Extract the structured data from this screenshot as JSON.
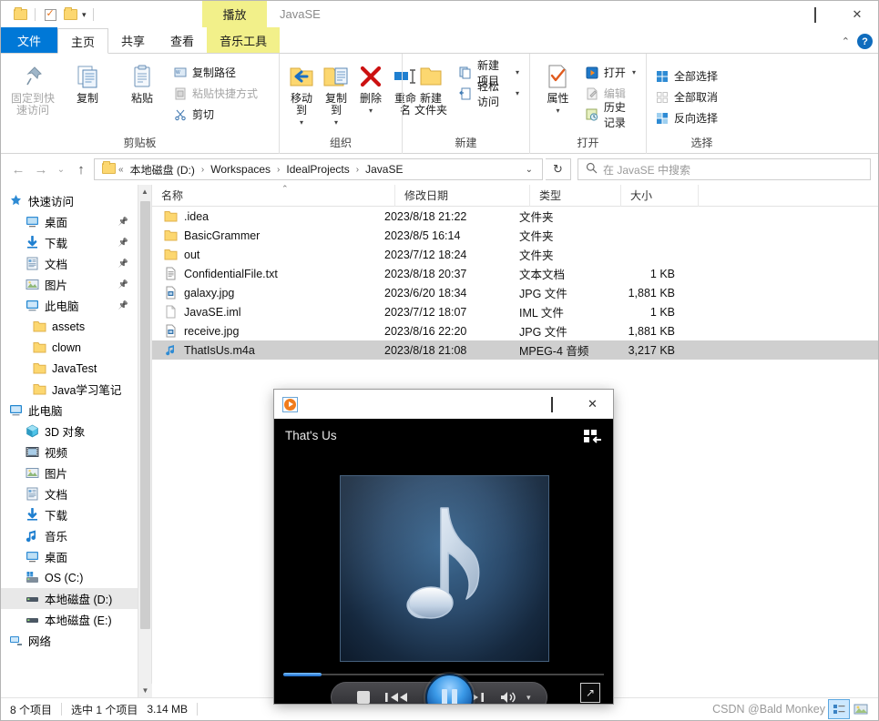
{
  "window": {
    "title": "JavaSE",
    "context_tab_top": "播放",
    "context_group_label": "音乐工具",
    "minimize": "—",
    "maximize": "□",
    "close": "✕",
    "collapse_ribbon": "⌃",
    "help": "?"
  },
  "ribbon": {
    "tabs": [
      {
        "label": "文件",
        "type": "file"
      },
      {
        "label": "主页",
        "type": "active"
      },
      {
        "label": "共享",
        "type": "normal"
      },
      {
        "label": "查看",
        "type": "normal"
      },
      {
        "label": "音乐工具",
        "type": "contextual"
      }
    ],
    "groups": [
      {
        "title": "剪贴板",
        "big": [
          {
            "label1": "固定到快",
            "label2": "速访问",
            "icon": "pin-icon",
            "disabled": true
          },
          {
            "label1": "复制",
            "label2": "",
            "icon": "copy-icon",
            "disabled": false
          },
          {
            "label1": "粘贴",
            "label2": "",
            "icon": "paste-icon",
            "disabled": false
          }
        ],
        "small": [
          {
            "label": "复制路径",
            "icon": "copy-path-icon"
          },
          {
            "label": "粘贴快捷方式",
            "icon": "paste-shortcut-icon",
            "disabled": true
          },
          {
            "label": "剪切",
            "icon": "scissors-icon"
          }
        ]
      },
      {
        "title": "组织",
        "big": [
          {
            "label1": "移动到",
            "label2": "",
            "icon": "move-to-icon",
            "caret": "▾"
          },
          {
            "label1": "复制到",
            "label2": "",
            "icon": "copy-to-icon",
            "caret": "▾"
          },
          {
            "label1": "删除",
            "label2": "",
            "icon": "delete-icon",
            "caret": "▾"
          },
          {
            "label1": "重命名",
            "label2": "",
            "icon": "rename-icon"
          }
        ]
      },
      {
        "title": "新建",
        "big": [
          {
            "label1": "新建",
            "label2": "文件夹",
            "icon": "new-folder-icon"
          }
        ],
        "small": [
          {
            "label": "新建项目",
            "icon": "new-item-icon",
            "caret": "▾"
          },
          {
            "label": "轻松访问",
            "icon": "easy-access-icon",
            "caret": "▾"
          }
        ]
      },
      {
        "title": "打开",
        "big": [
          {
            "label1": "属性",
            "label2": "",
            "icon": "properties-icon",
            "caret": "▾"
          }
        ],
        "small": [
          {
            "label": "打开",
            "icon": "open-icon",
            "caret": "▾"
          },
          {
            "label": "编辑",
            "icon": "edit-icon",
            "disabled": true
          },
          {
            "label": "历史记录",
            "icon": "history-icon"
          }
        ]
      },
      {
        "title": "选择",
        "small": [
          {
            "label": "全部选择",
            "icon": "select-all-icon"
          },
          {
            "label": "全部取消",
            "icon": "select-none-icon"
          },
          {
            "label": "反向选择",
            "icon": "invert-selection-icon"
          }
        ]
      }
    ]
  },
  "address": {
    "back": "←",
    "forward": "→",
    "recent": "⌄",
    "up": "↑",
    "prefix": "«",
    "crumbs": [
      "本地磁盘 (D:)",
      "Workspaces",
      "IdealProjects",
      "JavaSE"
    ],
    "separator": "›",
    "dropdown": "⌄",
    "refresh": "↻",
    "search_placeholder": "在 JavaSE 中搜索"
  },
  "nav": {
    "items": [
      {
        "label": "快速访问",
        "icon": "quick-access-star-icon",
        "indent": 0,
        "pinned": false,
        "selected": false
      },
      {
        "label": "桌面",
        "icon": "desktop-icon",
        "indent": 1,
        "pinned": true,
        "selected": false
      },
      {
        "label": "下载",
        "icon": "downloads-icon",
        "indent": 1,
        "pinned": true,
        "selected": false
      },
      {
        "label": "文档",
        "icon": "documents-icon",
        "indent": 1,
        "pinned": true,
        "selected": false
      },
      {
        "label": "图片",
        "icon": "pictures-icon",
        "indent": 1,
        "pinned": true,
        "selected": false
      },
      {
        "label": "此电脑",
        "icon": "this-pc-icon",
        "indent": 1,
        "pinned": true,
        "selected": false
      },
      {
        "label": "assets",
        "icon": "folder-icon",
        "indent": 2,
        "pinned": false,
        "selected": false
      },
      {
        "label": "clown",
        "icon": "folder-icon",
        "indent": 2,
        "pinned": false,
        "selected": false
      },
      {
        "label": "JavaTest",
        "icon": "folder-icon",
        "indent": 2,
        "pinned": false,
        "selected": false
      },
      {
        "label": "Java学习笔记",
        "icon": "folder-icon",
        "indent": 2,
        "pinned": false,
        "selected": false
      },
      {
        "label": "此电脑",
        "icon": "this-pc-icon",
        "indent": 0,
        "pinned": false,
        "selected": false
      },
      {
        "label": "3D 对象",
        "icon": "3d-objects-icon",
        "indent": 1,
        "pinned": false,
        "selected": false
      },
      {
        "label": "视频",
        "icon": "videos-icon",
        "indent": 1,
        "pinned": false,
        "selected": false
      },
      {
        "label": "图片",
        "icon": "pictures-icon",
        "indent": 1,
        "pinned": false,
        "selected": false
      },
      {
        "label": "文档",
        "icon": "documents-icon",
        "indent": 1,
        "pinned": false,
        "selected": false
      },
      {
        "label": "下载",
        "icon": "downloads-icon",
        "indent": 1,
        "pinned": false,
        "selected": false
      },
      {
        "label": "音乐",
        "icon": "music-icon",
        "indent": 1,
        "pinned": false,
        "selected": false
      },
      {
        "label": "桌面",
        "icon": "desktop-icon",
        "indent": 1,
        "pinned": false,
        "selected": false
      },
      {
        "label": "OS (C:)",
        "icon": "os-drive-icon",
        "indent": 1,
        "pinned": false,
        "selected": false
      },
      {
        "label": "本地磁盘 (D:)",
        "icon": "drive-icon",
        "indent": 1,
        "pinned": false,
        "selected": true
      },
      {
        "label": "本地磁盘 (E:)",
        "icon": "drive-icon",
        "indent": 1,
        "pinned": false,
        "selected": false
      },
      {
        "label": "网络",
        "icon": "network-icon",
        "indent": 0,
        "pinned": false,
        "selected": false
      }
    ]
  },
  "filelist": {
    "columns": [
      "名称",
      "修改日期",
      "类型",
      "大小"
    ],
    "sort_indicator": "⌃",
    "rows": [
      {
        "name": ".idea",
        "date": "2023/8/18 21:22",
        "type": "文件夹",
        "size": "",
        "icon": "folder-icon",
        "selected": false
      },
      {
        "name": "BasicGrammer",
        "date": "2023/8/5 16:14",
        "type": "文件夹",
        "size": "",
        "icon": "folder-icon",
        "selected": false
      },
      {
        "name": "out",
        "date": "2023/7/12 18:24",
        "type": "文件夹",
        "size": "",
        "icon": "folder-icon",
        "selected": false
      },
      {
        "name": "ConfidentialFile.txt",
        "date": "2023/8/18 20:37",
        "type": "文本文档",
        "size": "1 KB",
        "icon": "text-file-icon",
        "selected": false
      },
      {
        "name": "galaxy.jpg",
        "date": "2023/6/20 18:34",
        "type": "JPG 文件",
        "size": "1,881 KB",
        "icon": "image-file-icon",
        "selected": false
      },
      {
        "name": "JavaSE.iml",
        "date": "2023/7/12 18:07",
        "type": "IML 文件",
        "size": "1 KB",
        "icon": "blank-file-icon",
        "selected": false
      },
      {
        "name": "receive.jpg",
        "date": "2023/8/16 22:20",
        "type": "JPG 文件",
        "size": "1,881 KB",
        "icon": "image-file-icon",
        "selected": false
      },
      {
        "name": "ThatIsUs.m4a",
        "date": "2023/8/18 21:08",
        "type": "MPEG-4 音频",
        "size": "3,217 KB",
        "icon": "audio-file-icon",
        "selected": true
      }
    ]
  },
  "status": {
    "item_count": "8 个项目",
    "selection": "选中 1 个项目",
    "selection_size": "3.14 MB",
    "watermark": "CSDN @Bald Monkey",
    "view_details_icon": "details-view-icon",
    "view_large_icon": "large-icons-view-icon"
  },
  "player": {
    "logo": "wmp-logo-icon",
    "minimize": "—",
    "maximize": "□",
    "close": "✕",
    "song_title": "That's Us",
    "switch_to_library": "switch-to-library-icon",
    "album_art": "music-note-art",
    "seek_percent": "12",
    "controls": {
      "stop": "stop-icon",
      "previous": "previous-icon",
      "play_pause": "pause-icon",
      "next": "next-icon",
      "volume": "volume-icon",
      "volume_caret": "▾",
      "fullscreen": "↗"
    }
  },
  "colors": {
    "accent": "#0078d7",
    "contextual_tab": "#f2f08a",
    "selection": "#cfcfcf",
    "folder": "#fcd770"
  }
}
